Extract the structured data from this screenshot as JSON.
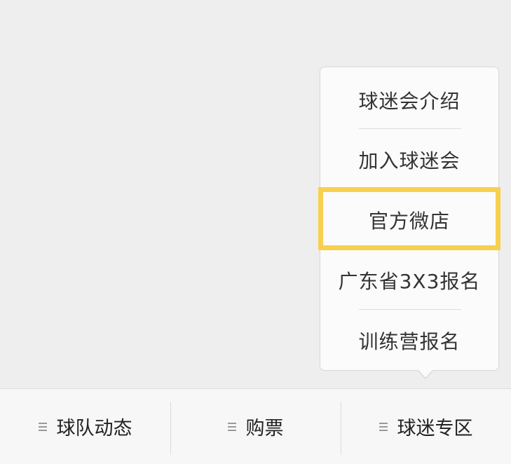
{
  "popup_menu": {
    "items": [
      {
        "label": "球迷会介绍"
      },
      {
        "label": "加入球迷会"
      },
      {
        "label": "官方微店"
      },
      {
        "label": "广东省3X3报名"
      },
      {
        "label": "训练营报名"
      }
    ],
    "highlighted_index": 2,
    "highlight_color": "#f7d04f"
  },
  "bottom_nav": {
    "tabs": [
      {
        "label": "球队动态",
        "icon": "menu-icon"
      },
      {
        "label": "购票",
        "icon": "menu-icon"
      },
      {
        "label": "球迷专区",
        "icon": "menu-icon"
      }
    ]
  }
}
